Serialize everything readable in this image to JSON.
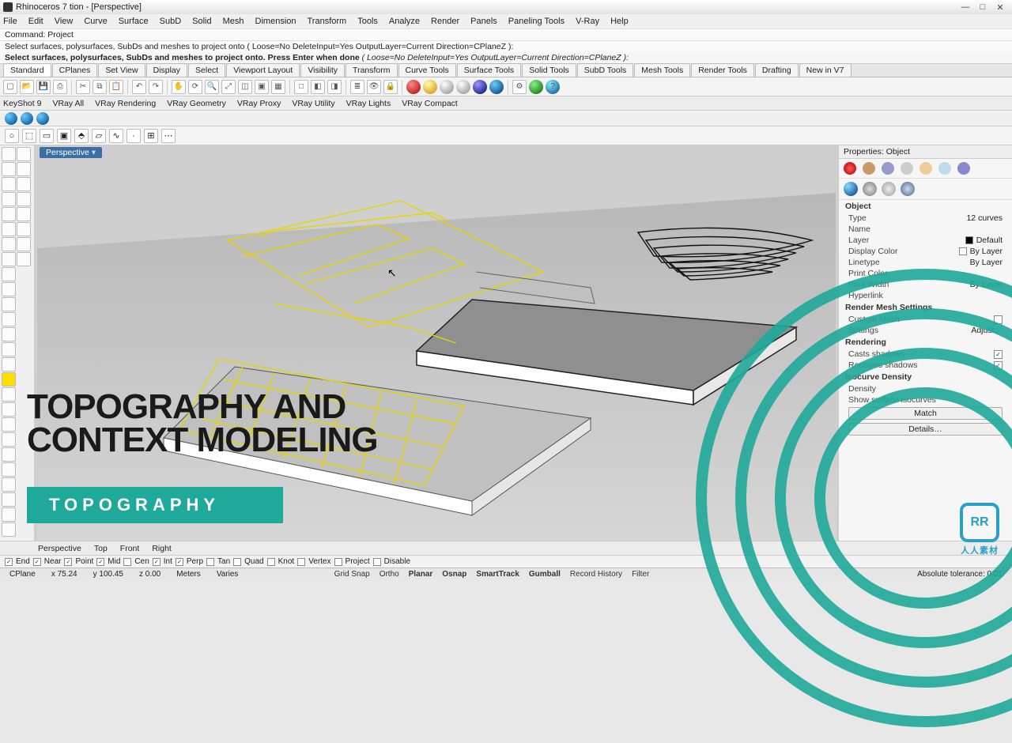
{
  "window": {
    "title": "Rhinoceros 7 tion - [Perspective]"
  },
  "menu": [
    "File",
    "Edit",
    "View",
    "Curve",
    "Surface",
    "SubD",
    "Solid",
    "Mesh",
    "Dimension",
    "Transform",
    "Tools",
    "Analyze",
    "Render",
    "Panels",
    "Paneling Tools",
    "V-Ray",
    "Help"
  ],
  "command_history": {
    "line1": "Command: Project",
    "line2": "Select surfaces, polysurfaces, SubDs and meshes to project onto ( Loose=No  DeleteInput=Yes  OutputLayer=Current  Direction=CPlaneZ ):"
  },
  "command_prompt": {
    "prefix": "Select surfaces, polysurfaces, SubDs and meshes to project onto. Press Enter when done",
    "options": "( Loose=No  DeleteInput=Yes  OutputLayer=Current  Direction=CPlaneZ ):",
    "input": ""
  },
  "tabs": [
    "Standard",
    "CPlanes",
    "Set View",
    "Display",
    "Select",
    "Viewport Layout",
    "Visibility",
    "Transform",
    "Curve Tools",
    "Surface Tools",
    "Solid Tools",
    "SubD Tools",
    "Mesh Tools",
    "Render Tools",
    "Drafting",
    "New in V7"
  ],
  "tabs_active": "Standard",
  "plugin_tabs": [
    "KeyShot 9",
    "VRay All",
    "VRay Rendering",
    "VRay Geometry",
    "VRay Proxy",
    "VRay Utility",
    "VRay Lights",
    "VRay Compact"
  ],
  "viewport": {
    "name": "Perspective"
  },
  "bottom_view_tabs": [
    "Perspective",
    "Top",
    "Front",
    "Right"
  ],
  "properties": {
    "title": "Properties: Object",
    "section_object": "Object",
    "rows": {
      "type": {
        "label": "Type",
        "value": "12 curves"
      },
      "name": {
        "label": "Name",
        "value": ""
      },
      "layer": {
        "label": "Layer",
        "value": "Default"
      },
      "display_color": {
        "label": "Display Color",
        "value": "By Layer"
      },
      "linetype": {
        "label": "Linetype",
        "value": "By Layer"
      },
      "print_color": {
        "label": "Print Color",
        "value": ""
      },
      "print_width": {
        "label": "Print Width",
        "value": "By Layer"
      },
      "hyperlink": {
        "label": "Hyperlink",
        "value": ""
      }
    },
    "section_mesh": "Render Mesh Settings",
    "mesh_rows": {
      "custom_mesh": {
        "label": "Custom Mesh",
        "value": ""
      },
      "settings": {
        "label": "Settings",
        "value": "Adjust…"
      }
    },
    "section_render": "Rendering",
    "render_rows": {
      "casts": {
        "label": "Casts shadows",
        "checked": true
      },
      "receives": {
        "label": "Receives shadows",
        "checked": true
      }
    },
    "section_iso": "Isocurve Density",
    "iso_rows": {
      "density": {
        "label": "Density",
        "value": ""
      },
      "show_iso": {
        "label": "Show surface isocurves",
        "value": ""
      }
    },
    "buttons": {
      "match": "Match",
      "details": "Details…"
    }
  },
  "osnap": {
    "items": [
      {
        "label": "End",
        "on": true
      },
      {
        "label": "Near",
        "on": true
      },
      {
        "label": "Point",
        "on": true
      },
      {
        "label": "Mid",
        "on": true
      },
      {
        "label": "Cen",
        "on": false
      },
      {
        "label": "Int",
        "on": true
      },
      {
        "label": "Perp",
        "on": true
      },
      {
        "label": "Tan",
        "on": false
      },
      {
        "label": "Quad",
        "on": false
      },
      {
        "label": "Knot",
        "on": false
      },
      {
        "label": "Vertex",
        "on": false
      },
      {
        "label": "Project",
        "on": false
      },
      {
        "label": "Disable",
        "on": false
      }
    ]
  },
  "status": {
    "cplane": "CPlane",
    "x": "x 75.24",
    "y": "y 100.45",
    "z": "z 0.00",
    "units": "Meters",
    "layer": "Varies",
    "toggles": [
      "Grid Snap",
      "Ortho",
      "Planar",
      "Osnap",
      "SmartTrack",
      "Gumball",
      "Record History",
      "Filter"
    ],
    "toggles_on": [
      "Planar",
      "Osnap",
      "SmartTrack",
      "Gumball"
    ],
    "right": "Absolute tolerance: 0.01"
  },
  "overlay": {
    "title_line1": "TOPOGRAPHY AND",
    "title_line2": "CONTEXT MODELING",
    "subtitle": "TOPOGRAPHY",
    "logo_text": "人人素材",
    "logo_badge": "RR"
  }
}
